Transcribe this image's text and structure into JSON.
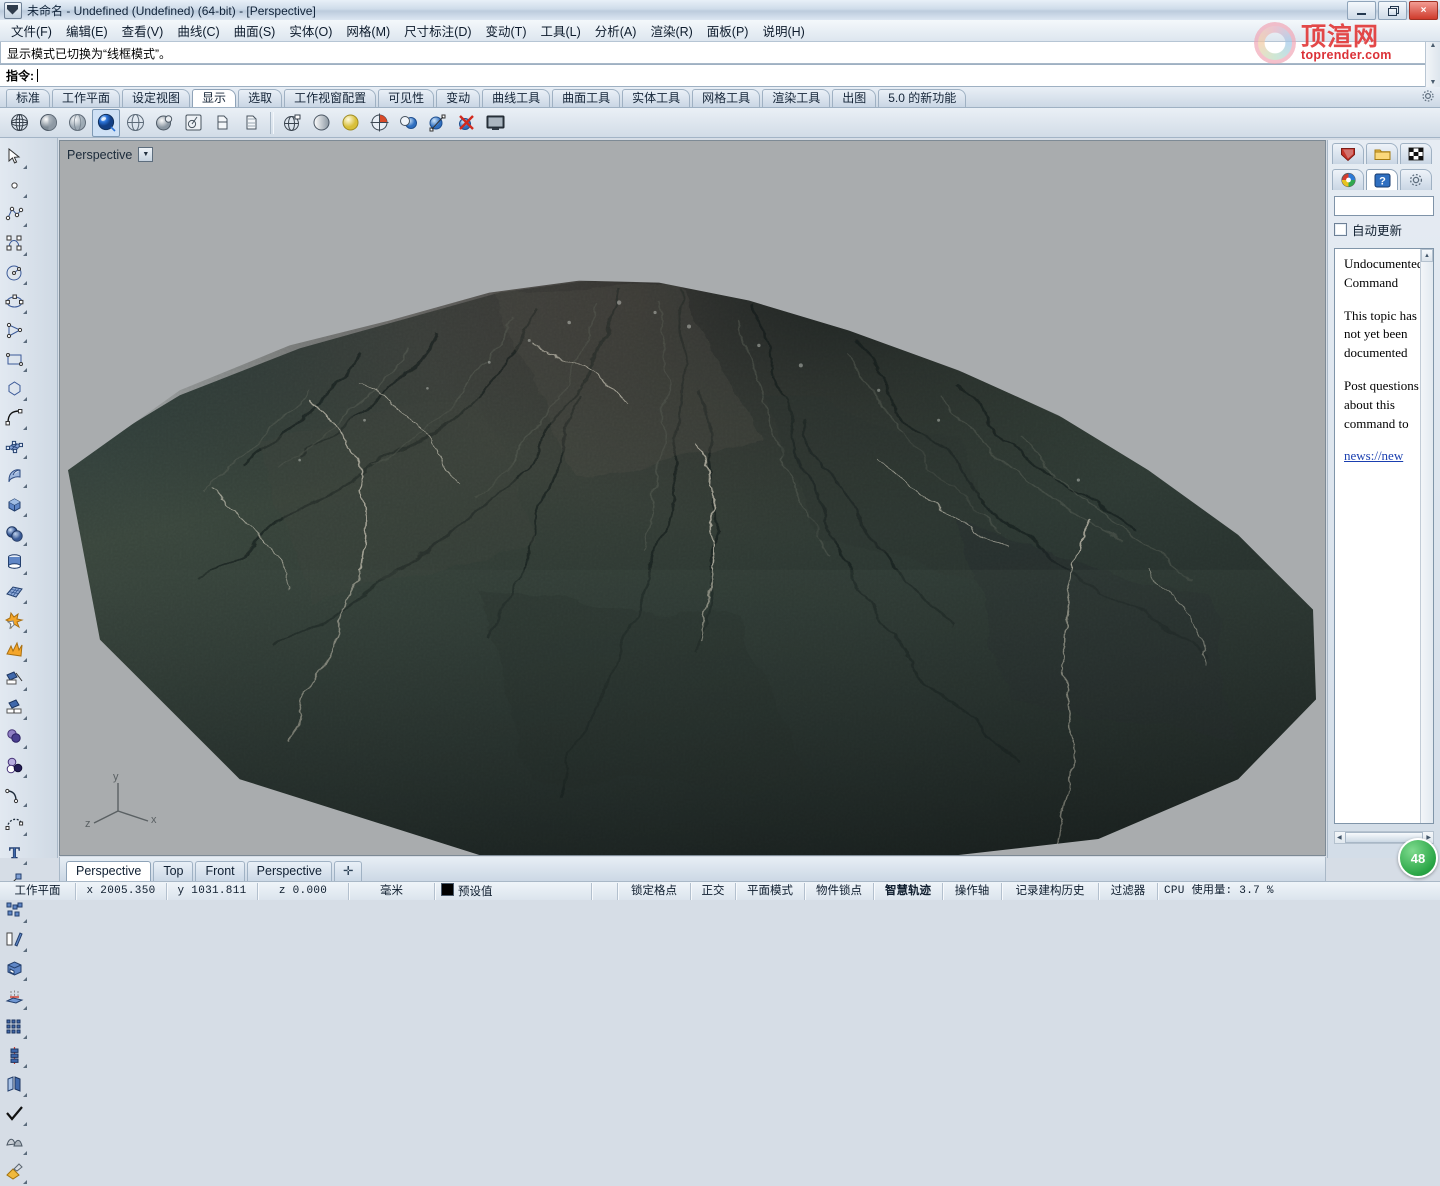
{
  "window": {
    "title": "未命名 - Undefined (Undefined) (64-bit) - [Perspective]",
    "app_icon": "rhino-logo-icon",
    "buttons": {
      "minimize": "minimize-button",
      "restore": "restore-button",
      "close": "×"
    }
  },
  "menu": {
    "items": [
      {
        "label": "文件(F)"
      },
      {
        "label": "编辑(E)"
      },
      {
        "label": "查看(V)"
      },
      {
        "label": "曲线(C)"
      },
      {
        "label": "曲面(S)"
      },
      {
        "label": "实体(O)"
      },
      {
        "label": "网格(M)"
      },
      {
        "label": "尺寸标注(D)"
      },
      {
        "label": "变动(T)"
      },
      {
        "label": "工具(L)"
      },
      {
        "label": "分析(A)"
      },
      {
        "label": "渲染(R)"
      },
      {
        "label": "面板(P)"
      },
      {
        "label": "说明(H)"
      }
    ]
  },
  "command": {
    "history": "显示模式已切换为“线框模式”。",
    "prompt_label": "指令:",
    "prompt_value": ""
  },
  "toolbar_tabs": {
    "active": "显示",
    "items": [
      {
        "label": "标准"
      },
      {
        "label": "工作平面"
      },
      {
        "label": "设定视图"
      },
      {
        "label": "显示"
      },
      {
        "label": "选取"
      },
      {
        "label": "工作视窗配置"
      },
      {
        "label": "可见性"
      },
      {
        "label": "变动"
      },
      {
        "label": "曲线工具"
      },
      {
        "label": "曲面工具"
      },
      {
        "label": "实体工具"
      },
      {
        "label": "网格工具"
      },
      {
        "label": "渲染工具"
      },
      {
        "label": "出图"
      },
      {
        "label": "5.0 的新功能"
      }
    ]
  },
  "display_toolbar": {
    "buttons": [
      {
        "name": "wireframe-display-icon",
        "selected": false
      },
      {
        "name": "shaded-display-icon",
        "selected": false
      },
      {
        "name": "ghosted-display-icon",
        "selected": false
      },
      {
        "name": "rendered-display-icon",
        "selected": true
      },
      {
        "name": "technical-display-icon",
        "selected": false
      },
      {
        "name": "artistic-display-icon",
        "selected": false
      },
      {
        "name": "pen-display-icon",
        "selected": false
      },
      {
        "name": "xray-display-icon",
        "selected": false
      },
      {
        "name": "zebra-display-icon",
        "selected": false
      },
      {
        "name": "curvature-display-icon",
        "selected": false
      },
      {
        "name": "flat-shade-icon",
        "selected": false
      },
      {
        "name": "shadow-light-icon",
        "selected": false
      },
      {
        "name": "clipping-plane-icon",
        "selected": false
      },
      {
        "name": "ground-plane-icon",
        "selected": false
      },
      {
        "name": "set-camera-icon",
        "selected": false
      },
      {
        "name": "remove-camera-icon",
        "selected": false
      },
      {
        "name": "fullscreen-display-icon",
        "selected": false
      }
    ]
  },
  "left_toolbar": {
    "buttons": [
      {
        "name": "select-arrow-icon"
      },
      {
        "name": "point-icon"
      },
      {
        "name": "polyline-icon"
      },
      {
        "name": "curve-control-points-icon"
      },
      {
        "name": "circle-icon"
      },
      {
        "name": "ellipse-icon"
      },
      {
        "name": "polygon-triangle-icon"
      },
      {
        "name": "rectangle-icon"
      },
      {
        "name": "hexagon-icon"
      },
      {
        "name": "arc-icon"
      },
      {
        "name": "surface-control-points-icon"
      },
      {
        "name": "extrude-surface-icon"
      },
      {
        "name": "box-solid-icon"
      },
      {
        "name": "sphere-boolean-icon"
      },
      {
        "name": "cylinder-icon"
      },
      {
        "name": "mesh-plane-icon"
      },
      {
        "name": "boolean-union-icon"
      },
      {
        "name": "explode-icon"
      },
      {
        "name": "trim-icon"
      },
      {
        "name": "split-icon"
      },
      {
        "name": "boolean-solids-icon"
      },
      {
        "name": "boolean-difference-icon"
      },
      {
        "name": "fillet-curve-icon"
      },
      {
        "name": "blend-curve-icon"
      },
      {
        "name": "text-tool-icon"
      },
      {
        "name": "scale-icon"
      },
      {
        "name": "array-icon"
      },
      {
        "name": "offset-icon"
      },
      {
        "name": "cap-holes-icon"
      },
      {
        "name": "project-icon"
      },
      {
        "name": "grid-array-icon"
      },
      {
        "name": "array-along-curve-icon"
      },
      {
        "name": "mirror-icon"
      },
      {
        "name": "check-objects-icon"
      },
      {
        "name": "split-surface-icon"
      },
      {
        "name": "apply-material-icon"
      }
    ]
  },
  "viewport": {
    "label": "Perspective",
    "dropdown_glyph": "▼",
    "background_color": "#a9acae",
    "axes": {
      "x": "x",
      "y": "y",
      "z": "z"
    },
    "content": "shaded-terrain-mesh"
  },
  "viewport_tabs": {
    "active_index": 0,
    "items": [
      {
        "label": "Perspective"
      },
      {
        "label": "Top"
      },
      {
        "label": "Front"
      },
      {
        "label": "Perspective"
      }
    ],
    "add_label": "✛"
  },
  "right_panel": {
    "tabs_row1": [
      {
        "name": "rhino-render-icon",
        "active": false
      },
      {
        "name": "folder-icon",
        "active": false
      },
      {
        "name": "checkerboard-texture-icon",
        "active": false
      }
    ],
    "tabs_row2": [
      {
        "name": "color-wheel-icon",
        "active": false
      },
      {
        "name": "help-question-icon",
        "active": true
      },
      {
        "name": "gear-icon",
        "active": false
      }
    ],
    "search_value": "",
    "auto_update_label": "自动更新",
    "auto_update_checked": false,
    "help": {
      "heading": "Undocumented Command",
      "paragraph1": "This topic has not yet been documented",
      "paragraph2": "Post questions about this command to",
      "link": "news://new"
    }
  },
  "status_bar": {
    "cplane_label": "工作平面",
    "x": "x 2005.350",
    "y": "y 1031.811",
    "z": "z 0.000",
    "units": "毫米",
    "layer": "预设值",
    "layer_color": "#000000",
    "toggles": [
      {
        "label": "锁定格点",
        "bold": false
      },
      {
        "label": "正交",
        "bold": false
      },
      {
        "label": "平面模式",
        "bold": false
      },
      {
        "label": "物件锁点",
        "bold": false
      },
      {
        "label": "智慧轨迹",
        "bold": true
      },
      {
        "label": "操作轴",
        "bold": false
      },
      {
        "label": "记录建构历史",
        "bold": false
      },
      {
        "label": "过滤器",
        "bold": false
      }
    ],
    "cpu": "CPU 使用量: 3.7 %"
  },
  "watermark": {
    "chinese": "顶渲网",
    "english": "toprender.com",
    "color": "#d81f26"
  },
  "badge": {
    "text": "48"
  },
  "colors": {
    "viewport_bg": "#a9acae",
    "chrome": "#d6dde6",
    "accent_blue": "#2f6fc0",
    "close_red": "#cf3b2c"
  }
}
